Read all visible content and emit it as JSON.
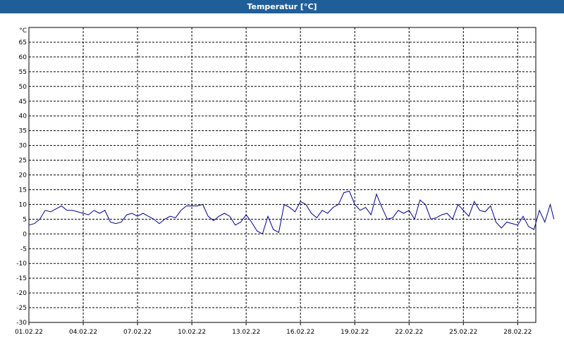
{
  "window": {
    "title": "Temperatur [°C]"
  },
  "chart_data": {
    "type": "line",
    "title": "Temperatur [°C]",
    "ylabel": "°C",
    "xlabel": "",
    "ylim": [
      -30,
      70
    ],
    "xlim": [
      "01.02.22",
      "01.03.22"
    ],
    "grid": true,
    "x_ticks": [
      "01.02.22",
      "04.02.22",
      "07.02.22",
      "10.02.22",
      "13.02.22",
      "16.02.22",
      "19.02.22",
      "22.02.22",
      "25.02.22",
      "28.02.22"
    ],
    "y_ticks": [
      65,
      60,
      55,
      50,
      45,
      40,
      35,
      30,
      25,
      20,
      15,
      10,
      5,
      0,
      -5,
      -10,
      -15,
      -20,
      -25,
      -30
    ],
    "series": [
      {
        "color": "#00008b",
        "x": [
          0,
          0.3,
          0.6,
          0.9,
          1.2,
          1.5,
          1.8,
          2.1,
          2.4,
          2.7,
          3.0,
          3.3,
          3.6,
          3.9,
          4.2,
          4.5,
          4.8,
          5.1,
          5.4,
          5.7,
          6.0,
          6.3,
          6.6,
          6.9,
          7.2,
          7.5,
          7.8,
          8.1,
          8.4,
          8.7,
          9.0,
          9.3,
          9.6,
          9.9,
          10.2,
          10.5,
          10.8,
          11.1,
          11.4,
          11.7,
          12.0,
          12.3,
          12.6,
          12.9,
          13.2,
          13.5,
          13.8,
          14.1,
          14.4,
          14.7,
          15.0,
          15.3,
          15.6,
          15.9,
          16.2,
          16.5,
          16.8,
          17.1,
          17.4,
          17.7,
          18.0,
          18.3,
          18.6,
          18.9,
          19.2,
          19.5,
          19.8,
          20.1,
          20.4,
          20.7,
          21.0,
          21.3,
          21.6,
          21.9,
          22.2,
          22.5,
          22.8,
          23.1,
          23.4,
          23.7,
          24.0,
          24.3,
          24.6,
          24.9,
          25.2,
          25.5,
          25.8,
          26.1,
          26.4,
          26.7,
          27.0,
          27.3,
          27.6,
          27.9,
          28.2,
          28.5,
          28.8,
          29.0
        ],
        "y": [
          3,
          3.5,
          5,
          8,
          7.5,
          8.5,
          9.5,
          8,
          8,
          7.5,
          7,
          6.5,
          8,
          7,
          8,
          4,
          3.5,
          4,
          6.5,
          7,
          6,
          7,
          6,
          5,
          3.5,
          5,
          6,
          5.5,
          8,
          9.5,
          9.5,
          9.5,
          10,
          6,
          4.5,
          6,
          7,
          6,
          3,
          4,
          6.5,
          4,
          1,
          0,
          6,
          1.5,
          0.5,
          10,
          9,
          7.5,
          11,
          10,
          7,
          5.5,
          8,
          7,
          9,
          10,
          14,
          14.5,
          10,
          8,
          9,
          6.5,
          13.5,
          9,
          5,
          5.5,
          8,
          7,
          8,
          5,
          11.5,
          10,
          5,
          5.5,
          6.5,
          7,
          5,
          10,
          8,
          6,
          11,
          8,
          7.5,
          9.5,
          4,
          2,
          4,
          3.5,
          3,
          6,
          2.5,
          1.5,
          8,
          4,
          10,
          5
        ]
      }
    ]
  }
}
